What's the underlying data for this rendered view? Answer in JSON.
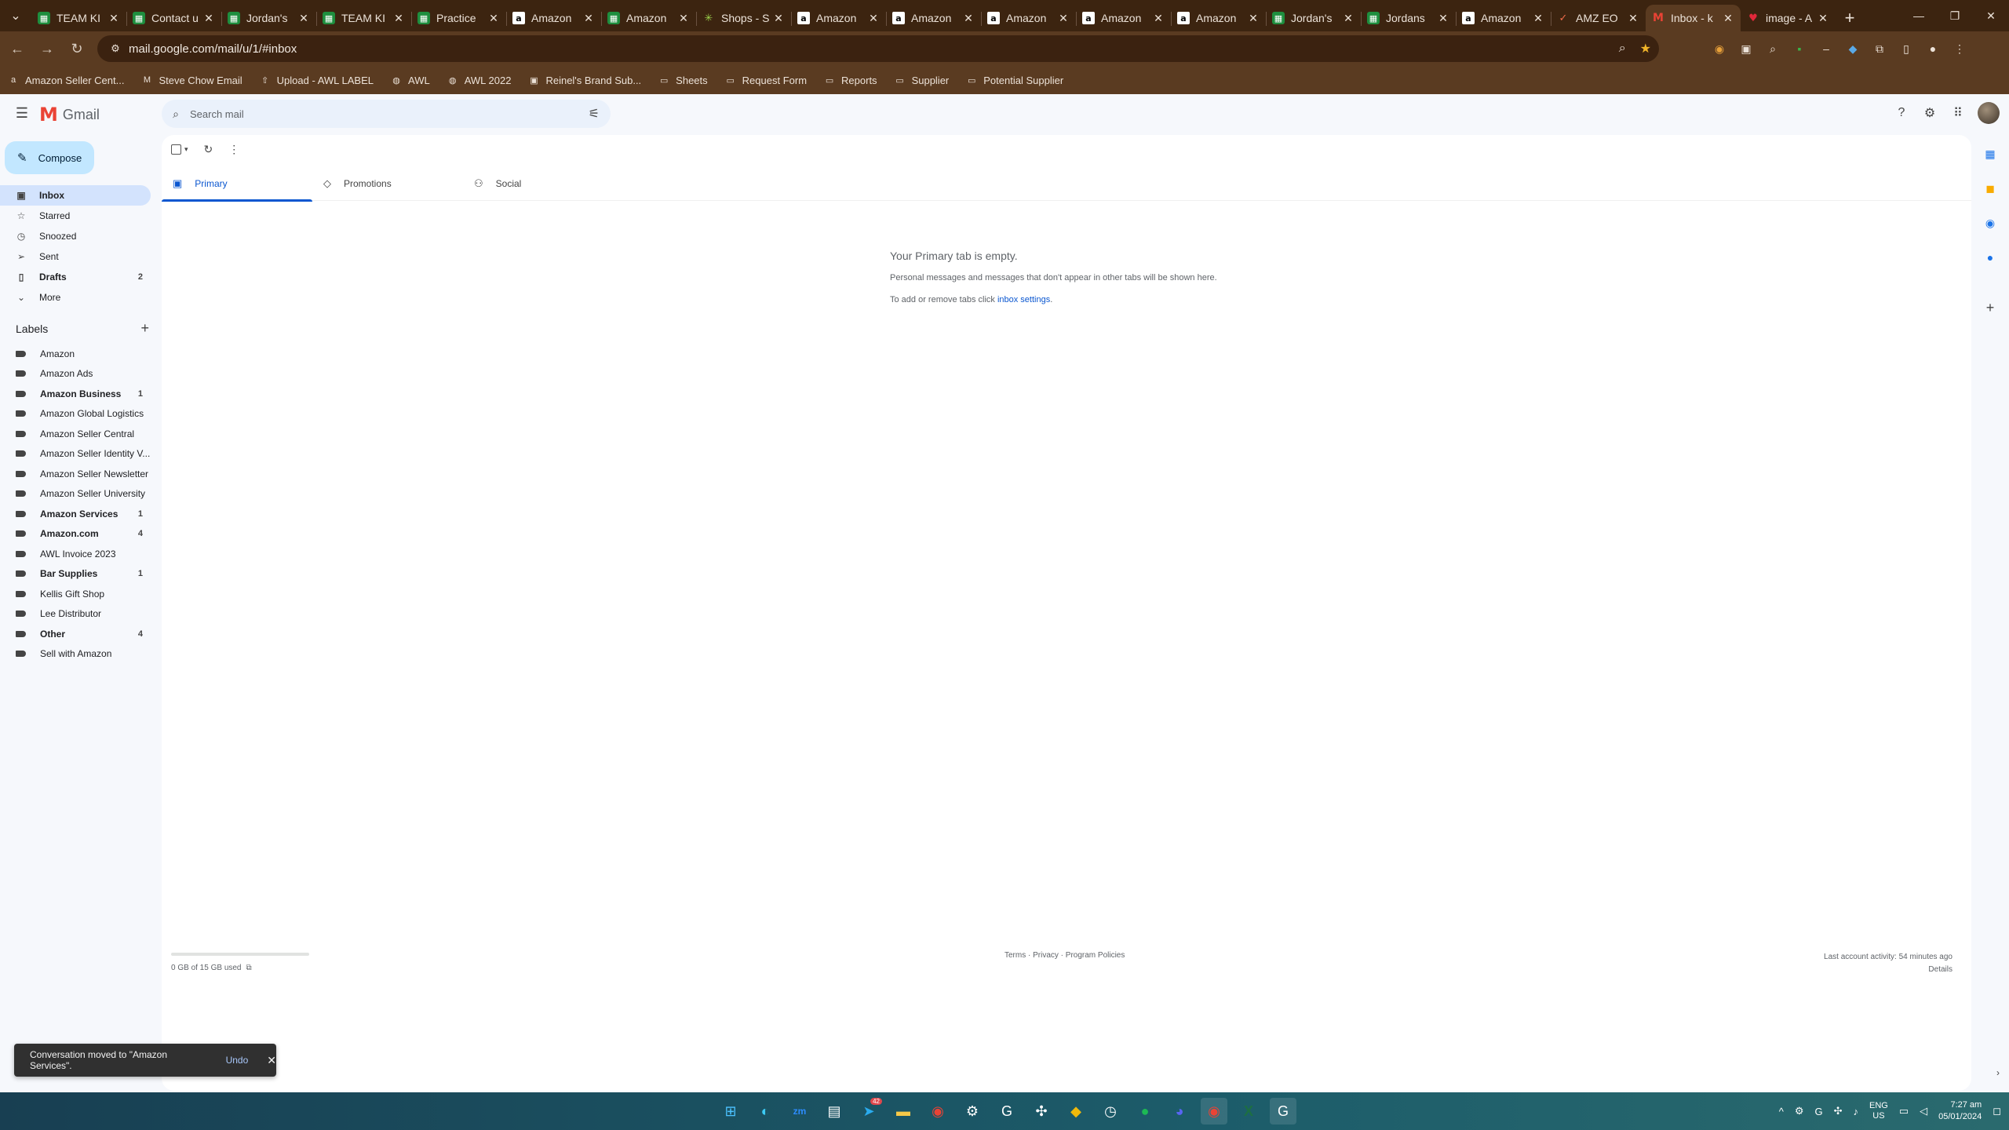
{
  "browser": {
    "tabs": [
      {
        "icon": "sheets",
        "title": "TEAM KI"
      },
      {
        "icon": "sheets",
        "title": "Contact u"
      },
      {
        "icon": "sheets",
        "title": "Jordan's"
      },
      {
        "icon": "sheets",
        "title": "TEAM KI"
      },
      {
        "icon": "sheets",
        "title": "Practice"
      },
      {
        "icon": "amazon",
        "title": "Amazon"
      },
      {
        "icon": "sheets",
        "title": "Amazon"
      },
      {
        "icon": "shops",
        "title": "Shops - S"
      },
      {
        "icon": "amazon",
        "title": "Amazon"
      },
      {
        "icon": "amazon",
        "title": "Amazon"
      },
      {
        "icon": "amazon",
        "title": "Amazon"
      },
      {
        "icon": "amazon",
        "title": "Amazon"
      },
      {
        "icon": "amazon",
        "title": "Amazon"
      },
      {
        "icon": "sheets",
        "title": "Jordan's"
      },
      {
        "icon": "sheets",
        "title": "Jordans"
      },
      {
        "icon": "amazon",
        "title": "Amazon"
      },
      {
        "icon": "amz",
        "title": "AMZ EO"
      },
      {
        "icon": "gmail",
        "title": "Inbox - k",
        "active": true
      },
      {
        "icon": "bms",
        "title": "image - A"
      }
    ],
    "url": "mail.google.com/mail/u/1/#inbox",
    "bookmarks": [
      {
        "icon": "amazon-icon",
        "label": "Amazon Seller Cent..."
      },
      {
        "icon": "gmail-icon",
        "label": "Steve Chow Email"
      },
      {
        "icon": "upload-icon",
        "label": "Upload - AWL LABEL"
      },
      {
        "icon": "globe-icon",
        "label": "AWL"
      },
      {
        "icon": "globe-icon",
        "label": "AWL 2022"
      },
      {
        "icon": "brand-icon",
        "label": "Reinel's Brand Sub..."
      },
      {
        "icon": "folder-icon",
        "label": "Sheets"
      },
      {
        "icon": "folder-icon",
        "label": "Request Form"
      },
      {
        "icon": "folder-icon",
        "label": "Reports"
      },
      {
        "icon": "folder-icon",
        "label": "Supplier"
      },
      {
        "icon": "folder-icon",
        "label": "Potential Supplier"
      }
    ]
  },
  "gmail": {
    "logo_text": "Gmail",
    "search_placeholder": "Search mail",
    "compose_label": "Compose",
    "nav": [
      {
        "icon": "inbox-icon",
        "label": "Inbox",
        "count": "",
        "active": true
      },
      {
        "icon": "star-icon",
        "label": "Starred",
        "count": ""
      },
      {
        "icon": "clock-icon",
        "label": "Snoozed",
        "count": ""
      },
      {
        "icon": "send-icon",
        "label": "Sent",
        "count": ""
      },
      {
        "icon": "file-icon",
        "label": "Drafts",
        "count": "2",
        "bold": true
      },
      {
        "icon": "chevron-down-icon",
        "label": "More",
        "count": ""
      }
    ],
    "labels_title": "Labels",
    "labels": [
      {
        "label": "Amazon",
        "count": ""
      },
      {
        "label": "Amazon Ads",
        "count": ""
      },
      {
        "label": "Amazon Business",
        "count": "1",
        "bold": true
      },
      {
        "label": "Amazon Global Logistics",
        "count": ""
      },
      {
        "label": "Amazon Seller Central",
        "count": ""
      },
      {
        "label": "Amazon Seller Identity V...",
        "count": ""
      },
      {
        "label": "Amazon Seller Newsletter",
        "count": ""
      },
      {
        "label": "Amazon Seller University",
        "count": ""
      },
      {
        "label": "Amazon Services",
        "count": "1",
        "bold": true
      },
      {
        "label": "Amazon.com",
        "count": "4",
        "bold": true
      },
      {
        "label": "AWL Invoice 2023",
        "count": ""
      },
      {
        "label": "Bar Supplies",
        "count": "1",
        "bold": true
      },
      {
        "label": "Kellis Gift Shop",
        "count": ""
      },
      {
        "label": "Lee Distributor",
        "count": ""
      },
      {
        "label": "Other",
        "count": "4",
        "bold": true
      },
      {
        "label": "Sell with Amazon",
        "count": ""
      }
    ],
    "category_tabs": [
      {
        "icon": "inbox-icon",
        "label": "Primary",
        "active": true
      },
      {
        "icon": "tag-icon",
        "label": "Promotions"
      },
      {
        "icon": "people-icon",
        "label": "Social"
      }
    ],
    "empty_state": {
      "title": "Your Primary tab is empty.",
      "line1": "Personal messages and messages that don't appear in other tabs will be shown here.",
      "line2_prefix": "To add or remove tabs click ",
      "line2_link": "inbox settings",
      "line2_suffix": "."
    },
    "footer": {
      "storage_fraction": 0.0,
      "storage_text": "0 GB of 15 GB used",
      "policies": "Terms · Privacy · Program Policies",
      "activity": "Last account activity: 54 minutes ago",
      "details": "Details"
    },
    "snackbar": {
      "message": "Conversation moved to \"Amazon Services\".",
      "undo": "Undo"
    }
  },
  "taskbar": {
    "telegram_badge": "42",
    "lang_top": "ENG",
    "lang_bottom": "US",
    "time": "7:27 am",
    "date": "05/01/2024"
  }
}
